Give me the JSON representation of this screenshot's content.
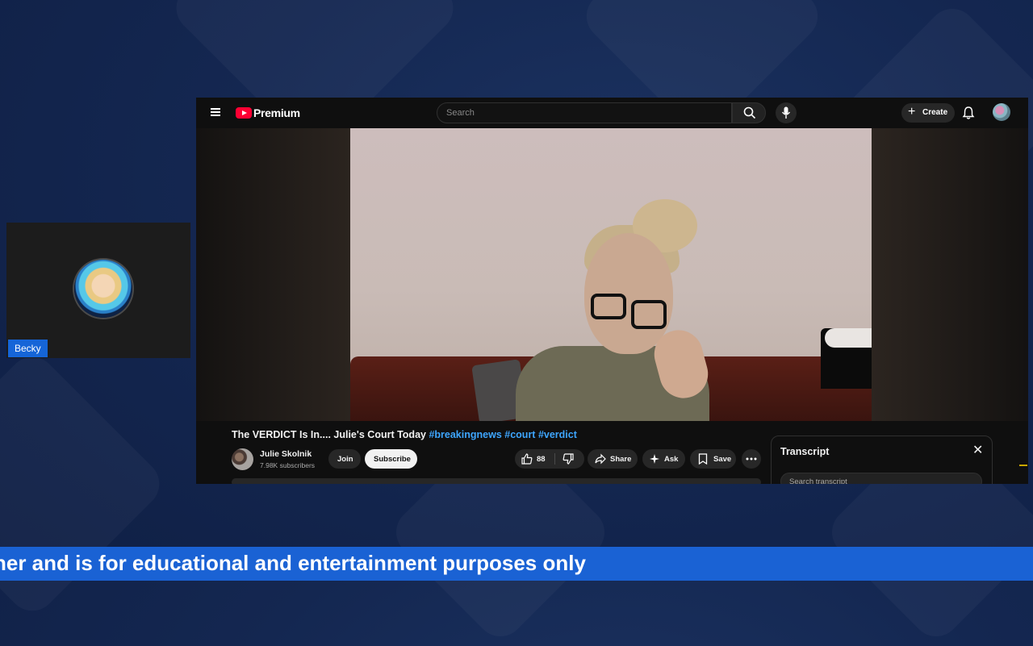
{
  "webcam": {
    "name": "Becky"
  },
  "youtube": {
    "logo_text": "Premium",
    "search_placeholder": "Search",
    "create_label": "Create",
    "video": {
      "title_main": "The VERDICT Is In.... Julie's Court Today",
      "hashtags": [
        "#breakingnews",
        "#court",
        "#verdict"
      ]
    },
    "channel": {
      "name": "Julie Skolnik",
      "subscribers": "7.98K subscribers"
    },
    "actions": {
      "join": "Join",
      "subscribe": "Subscribe",
      "likes": "88",
      "share": "Share",
      "ask": "Ask",
      "save": "Save"
    },
    "transcript": {
      "title": "Transcript",
      "search_placeholder": "Search transcript"
    }
  },
  "ticker": {
    "text": "her and is for educational and entertainment purposes only"
  },
  "colors": {
    "brand_red": "#ff0033",
    "hashtag_blue": "#3ea6ff",
    "ticker_blue": "#1a62d4",
    "name_tag_blue": "#1565d8"
  },
  "icons": [
    "menu-icon",
    "youtube-logo-icon",
    "search-icon",
    "mic-icon",
    "plus-icon",
    "bell-icon",
    "like-icon",
    "dislike-icon",
    "share-icon",
    "ask-sparkle-icon",
    "save-bookmark-icon",
    "more-icon",
    "close-icon"
  ]
}
